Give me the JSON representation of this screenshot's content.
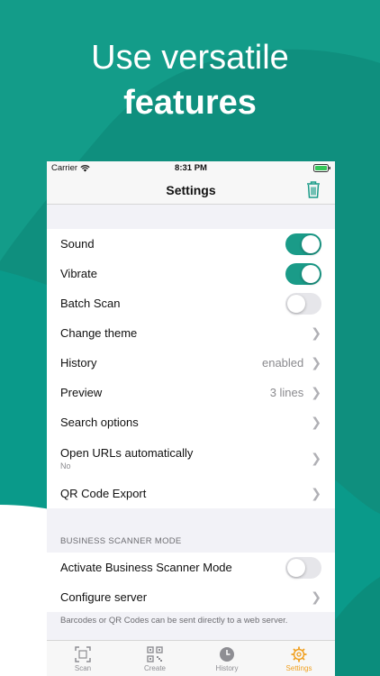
{
  "colors": {
    "accent": "#1a9b88",
    "active_tab": "#f0a020",
    "trash": "#1a9b88"
  },
  "headline": {
    "line1": "Use versatile",
    "line2": "features"
  },
  "status_bar": {
    "carrier": "Carrier",
    "time": "8:31 PM"
  },
  "nav": {
    "title": "Settings",
    "trash_icon": "trash-icon"
  },
  "settings": {
    "sound": {
      "label": "Sound",
      "on": true
    },
    "vibrate": {
      "label": "Vibrate",
      "on": true
    },
    "batch_scan": {
      "label": "Batch Scan",
      "on": false
    },
    "change_theme": {
      "label": "Change theme"
    },
    "history": {
      "label": "History",
      "value": "enabled"
    },
    "preview": {
      "label": "Preview",
      "value": "3 lines"
    },
    "search_options": {
      "label": "Search options"
    },
    "open_urls": {
      "label": "Open URLs automatically",
      "sub": "No"
    },
    "qr_export": {
      "label": "QR Code Export"
    }
  },
  "business": {
    "header": "BUSINESS SCANNER MODE",
    "activate": {
      "label": "Activate Business Scanner Mode",
      "on": false
    },
    "configure": {
      "label": "Configure server"
    },
    "footer": "Barcodes or QR Codes can be sent directly to a web server."
  },
  "tabs": [
    {
      "label": "Scan",
      "icon": "scan-icon"
    },
    {
      "label": "Create",
      "icon": "qr-code-icon"
    },
    {
      "label": "History",
      "icon": "clock-icon"
    },
    {
      "label": "Settings",
      "icon": "gear-icon",
      "active": true
    }
  ]
}
